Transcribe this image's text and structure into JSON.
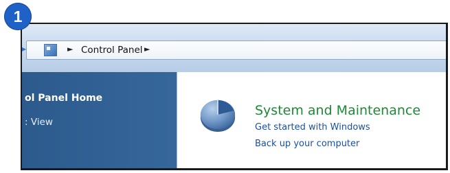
{
  "badge": {
    "number": "1"
  },
  "address_bar": {
    "breadcrumb": "Control Panel",
    "separator": "►"
  },
  "sidebar": {
    "home_label": "ol Panel Home",
    "view_label": ": View"
  },
  "category": {
    "title": "System and Maintenance",
    "links": [
      "Get started with Windows",
      "Back up your computer"
    ]
  },
  "colors": {
    "badge": "#1f62c7",
    "sidebar": "#2c5a8d",
    "category_title": "#1d8a35",
    "link": "#1a4fa3"
  }
}
